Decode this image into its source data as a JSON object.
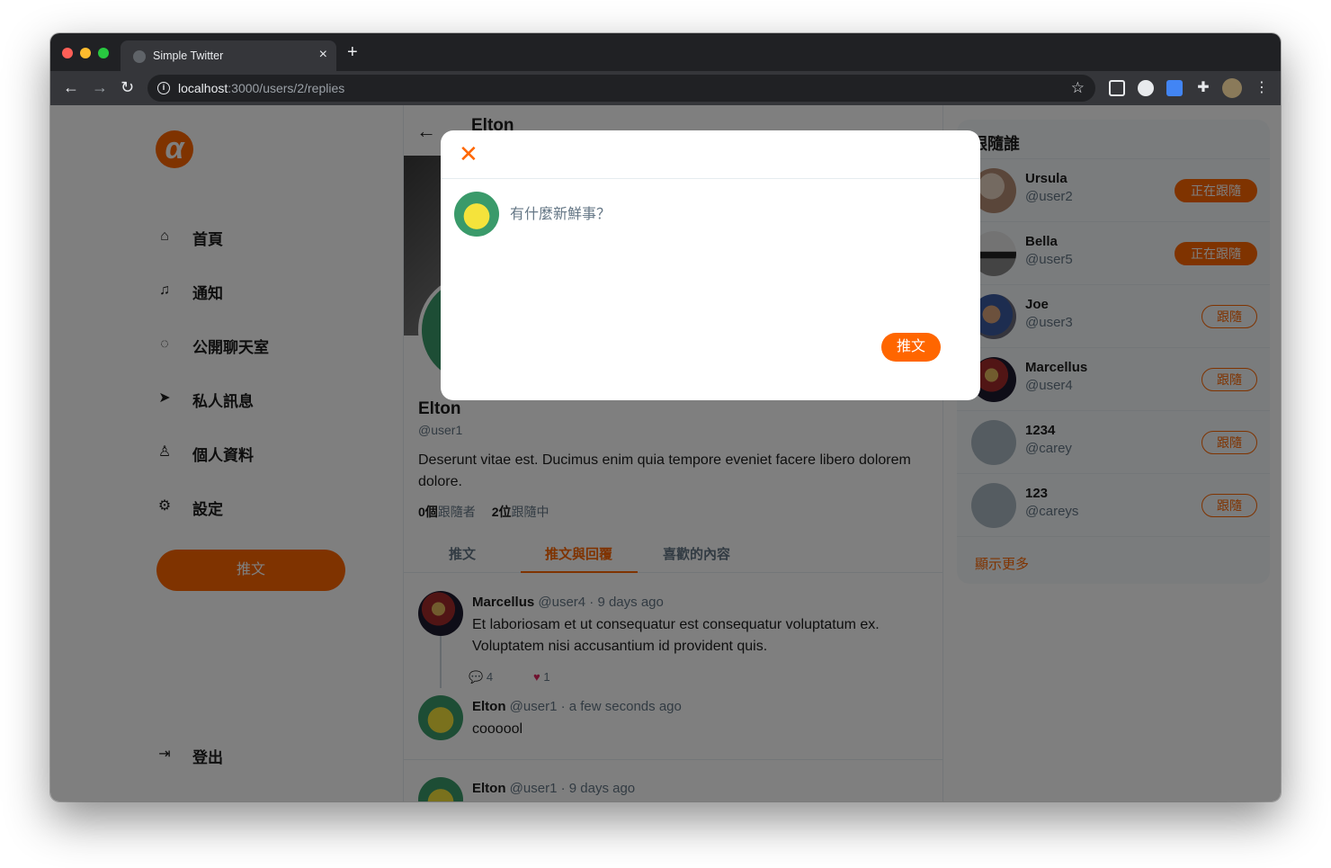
{
  "browser": {
    "tab_title": "Simple Twitter",
    "tab_close": "×",
    "new_tab": "+",
    "url_host": "localhost",
    "url_path": ":3000/users/2/replies",
    "info": "i"
  },
  "sidebar": {
    "logo": "α",
    "items": [
      {
        "label": "首頁",
        "icon": "home-icon",
        "glyph": "⌂"
      },
      {
        "label": "通知",
        "icon": "bell-icon",
        "glyph": "♫"
      },
      {
        "label": "公開聊天室",
        "icon": "chat-icon",
        "glyph": "◌"
      },
      {
        "label": "私人訊息",
        "icon": "paper-plane-icon",
        "glyph": "➤"
      },
      {
        "label": "個人資料",
        "icon": "user-icon",
        "glyph": "♙"
      },
      {
        "label": "設定",
        "icon": "gear-icon",
        "glyph": "⚙"
      }
    ],
    "tweet_button": "推文",
    "logout": {
      "label": "登出",
      "icon": "logout-icon",
      "glyph": "⇥"
    }
  },
  "profile": {
    "back": "←",
    "header_name": "Elton",
    "name": "Elton",
    "handle": "@user1",
    "bio": "Deserunt vitae est. Ducimus enim quia tempore eveniet facere libero dolorem dolore.",
    "followers_count": "0個",
    "followers_label": "跟隨者",
    "following_count": "2位",
    "following_label": "跟隨中"
  },
  "tabs": [
    "推文",
    "推文與回覆",
    "喜歡的內容"
  ],
  "feed": [
    {
      "name": "Marcellus",
      "handle": "@user4",
      "time": "· 9 days ago",
      "body": "Et laboriosam et ut consequatur est consequatur voluptatum ex. Voluptatem nisi accusantium id provident quis.",
      "replies": "4",
      "likes": "1"
    },
    {
      "name": "Elton",
      "handle": "@user1",
      "time": "· a few seconds ago",
      "body": "coooool"
    },
    {
      "name": "Elton",
      "handle": "@user1",
      "time": "· 9 days ago"
    }
  ],
  "rightbar": {
    "title": "跟隨誰",
    "users": [
      {
        "name": "Ursula",
        "handle": "@user2",
        "button": "正在跟隨",
        "state": "following"
      },
      {
        "name": "Bella",
        "handle": "@user5",
        "button": "正在跟隨",
        "state": "following"
      },
      {
        "name": "Joe",
        "handle": "@user3",
        "button": "跟隨",
        "state": "follow"
      },
      {
        "name": "Marcellus",
        "handle": "@user4",
        "button": "跟隨",
        "state": "follow"
      },
      {
        "name": "1234",
        "handle": "@carey",
        "button": "跟隨",
        "state": "follow"
      },
      {
        "name": "123",
        "handle": "@careys",
        "button": "跟隨",
        "state": "follow"
      }
    ],
    "more": "顯示更多"
  },
  "modal": {
    "close": "✕",
    "placeholder": "有什麼新鮮事？",
    "submit": "推文"
  },
  "colors": {
    "accent": "#ff6600",
    "overlay": "rgba(0,0,0,0.5)"
  }
}
